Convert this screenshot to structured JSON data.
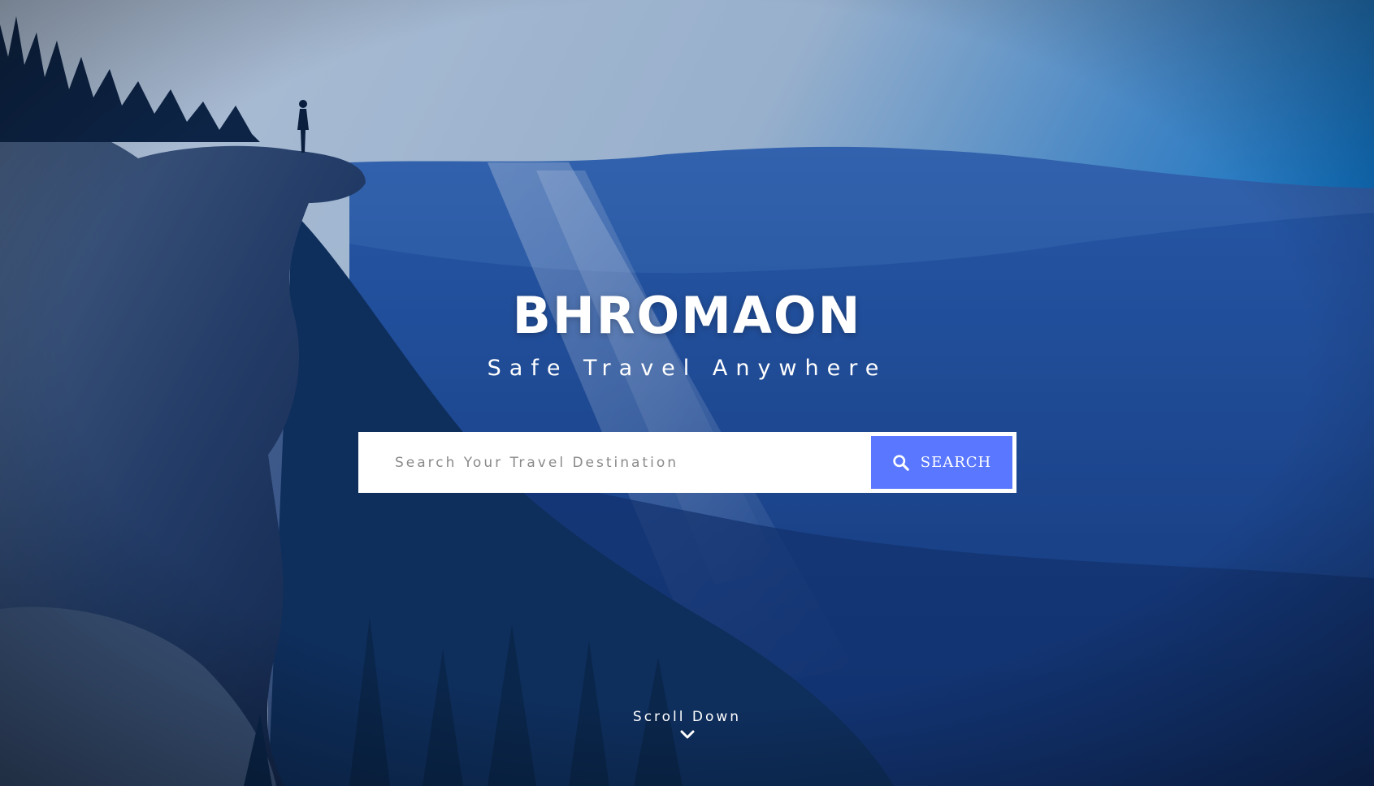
{
  "hero": {
    "title": "BHROMAON",
    "tagline": "Safe Travel Anywhere"
  },
  "search": {
    "placeholder": "Search Your Travel Destination",
    "button_label": "SEARCH",
    "button_icon": "search-icon"
  },
  "scroll": {
    "label": "Scroll Down",
    "icon": "chevron-down-icon"
  },
  "colors": {
    "accent": "#5a78ff",
    "text": "#ffffff",
    "sky_light": "#dfe6ea",
    "mountain_blue": "#234f9a",
    "deep_shadow": "#0c1f45"
  }
}
